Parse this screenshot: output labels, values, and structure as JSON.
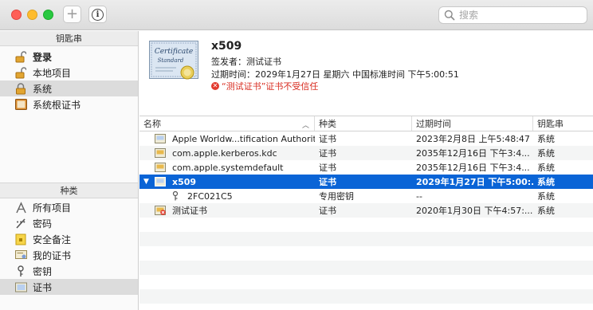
{
  "toolbar": {
    "search_placeholder": "搜索"
  },
  "sidebar": {
    "keychains_header": "钥匙串",
    "keychains": [
      {
        "label": "登录",
        "icon": "unlocked-padlock-icon",
        "bold": true
      },
      {
        "label": "本地项目",
        "icon": "unlocked-padlock-icon"
      },
      {
        "label": "系统",
        "icon": "locked-padlock-icon",
        "selected": true
      },
      {
        "label": "系统根证书",
        "icon": "cabinet-icon"
      }
    ],
    "category_header": "种类",
    "categories": [
      {
        "label": "所有项目",
        "icon": "all-items-icon"
      },
      {
        "label": "密码",
        "icon": "password-icon"
      },
      {
        "label": "安全备注",
        "icon": "secure-note-icon"
      },
      {
        "label": "我的证书",
        "icon": "my-certificate-icon"
      },
      {
        "label": "密钥",
        "icon": "key-icon"
      },
      {
        "label": "证书",
        "icon": "certificate-icon",
        "selected": true
      }
    ]
  },
  "detail": {
    "name": "x509",
    "issuer": "签发者：测试证书",
    "expires": "过期时间：2029年1月27日 星期六 中国标准时间 下午5:00:51",
    "warning": "“测试证书”证书不受信任",
    "badge_text": [
      "Certificate",
      "Standard"
    ]
  },
  "table": {
    "headers": [
      "名称",
      "种类",
      "过期时间",
      "钥匙串"
    ],
    "rows": [
      {
        "name": "Apple Worldw...tification Authority",
        "kind": "证书",
        "expires": "2023年2月8日 上午5:48:47",
        "keychain": "系统"
      },
      {
        "name": "com.apple.kerberos.kdc",
        "kind": "证书",
        "expires": "2035年12月16日 下午3:4...",
        "keychain": "系统"
      },
      {
        "name": "com.apple.systemdefault",
        "kind": "证书",
        "expires": "2035年12月16日 下午3:4...",
        "keychain": "系统"
      },
      {
        "name": "x509",
        "kind": "证书",
        "expires": "2029年1月27日 下午5:00:...",
        "keychain": "系统"
      },
      {
        "name": "2FC021C5",
        "kind": "专用密钥",
        "expires": "--",
        "keychain": "系统"
      },
      {
        "name": "测试证书",
        "kind": "证书",
        "expires": "2020年1月30日 下午4:57:...",
        "keychain": "系统"
      }
    ]
  },
  "colors": {
    "selection": "#0a64d6",
    "warning": "#d82c20"
  }
}
